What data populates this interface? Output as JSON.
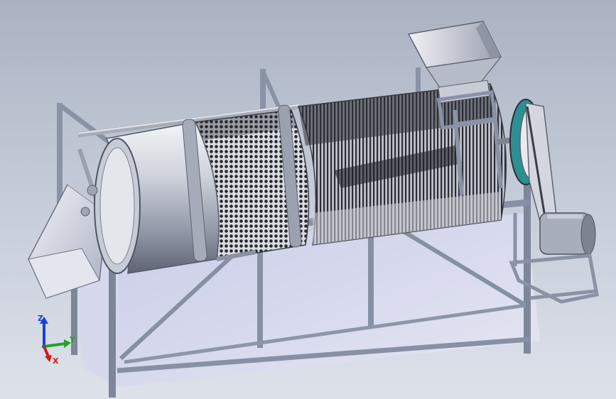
{
  "viewport": {
    "background_top": "#aab2c2",
    "background_bottom": "#dde2ea",
    "model_description_visible": false
  },
  "triad": {
    "x_label": "X",
    "y_label": "Y",
    "z_label": "Z",
    "x_color": "#d11a1a",
    "y_color": "#22a32a",
    "z_color": "#1f3fd6"
  },
  "parts": [
    {
      "name": "feed-hopper",
      "icon": "hopper-icon"
    },
    {
      "name": "solid-drum-section",
      "icon": "cylinder-icon"
    },
    {
      "name": "perforated-drum-section",
      "icon": "perforated-cylinder-icon"
    },
    {
      "name": "bar-screen-section",
      "icon": "bar-screen-icon"
    },
    {
      "name": "discharge-chute",
      "icon": "chute-icon"
    },
    {
      "name": "belt-pulley",
      "icon": "pulley-icon"
    },
    {
      "name": "drive-motor",
      "icon": "motor-icon"
    },
    {
      "name": "support-frame",
      "icon": "frame-icon"
    }
  ],
  "colors": {
    "frame": "#8a93a6",
    "frame_dark": "#5d6577",
    "drum_light": "#eef0f4",
    "drum_dark": "#6f7584",
    "screen_dark": "#2d2f36",
    "pulley_teal": "#2e8f93"
  }
}
